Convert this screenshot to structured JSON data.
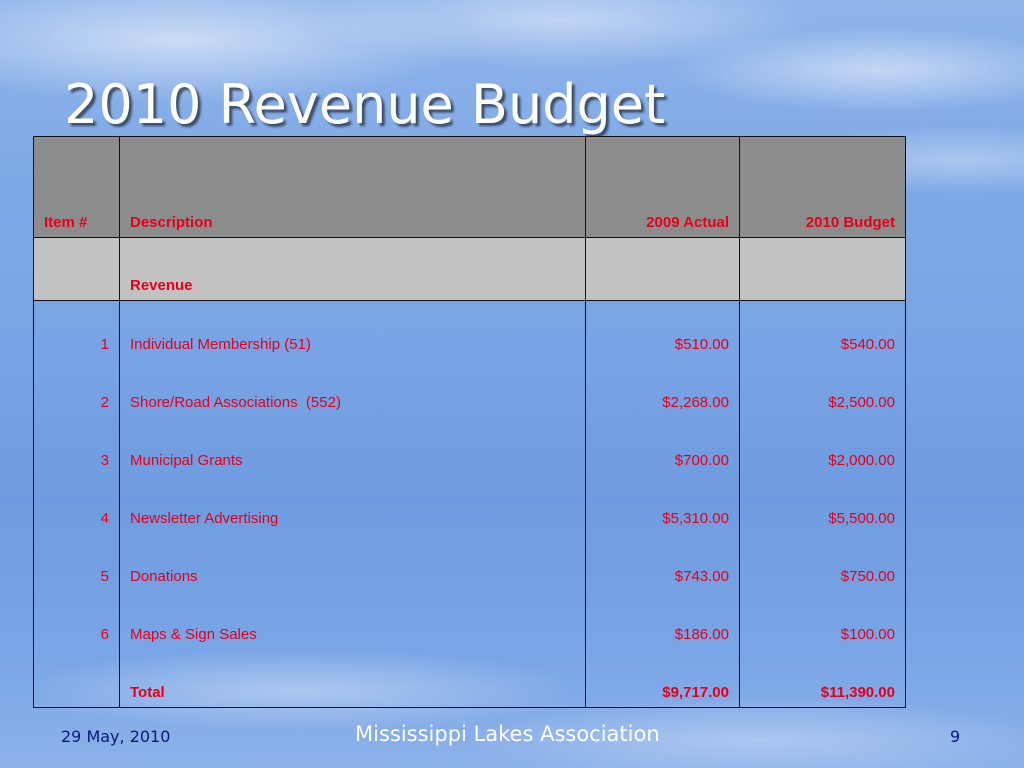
{
  "slide": {
    "title": "2010 Revenue Budget"
  },
  "table": {
    "headers": {
      "item": "Item #",
      "description": "Description",
      "actual_2009": "2009 Actual",
      "budget_2010": "2010 Budget"
    },
    "section_label": "Revenue",
    "rows": [
      {
        "item": "1",
        "description": "Individual Membership (51)",
        "actual_2009": "$510.00",
        "budget_2010": "$540.00"
      },
      {
        "item": "2",
        "description": "Shore/Road Associations  (552)",
        "actual_2009": "$2,268.00",
        "budget_2010": "$2,500.00"
      },
      {
        "item": "3",
        "description": "Municipal Grants",
        "actual_2009": "$700.00",
        "budget_2010": "$2,000.00"
      },
      {
        "item": "4",
        "description": "Newsletter Advertising",
        "actual_2009": "$5,310.00",
        "budget_2010": "$5,500.00"
      },
      {
        "item": "5",
        "description": "Donations",
        "actual_2009": "$743.00",
        "budget_2010": "$750.00"
      },
      {
        "item": "6",
        "description": "Maps & Sign Sales",
        "actual_2009": "$186.00",
        "budget_2010": "$100.00"
      }
    ],
    "total": {
      "label": "Total",
      "actual_2009": "$9,717.00",
      "budget_2010": "$11,390.00"
    }
  },
  "footer": {
    "date": "29 May, 2010",
    "organization": "Mississippi Lakes Association",
    "page_number": "9"
  },
  "colors": {
    "table_text": "#e4001b",
    "header_fill": "#8c8c8c",
    "section_fill": "#c2c2c2",
    "footer_text": "#0a1a7a"
  }
}
